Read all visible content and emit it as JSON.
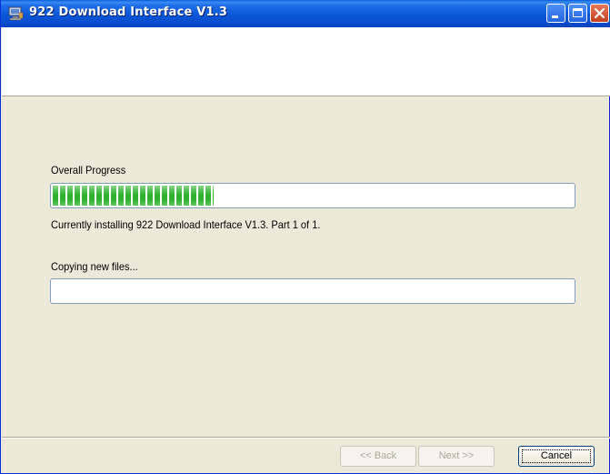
{
  "window": {
    "title": "922 Download Interface V1.3",
    "title_bar_color": "#0a56d6"
  },
  "progress": {
    "overall_label": "Overall Progress",
    "overall_fraction": 0.31,
    "overall_fill_color": "#2fb12f",
    "status_text": "Currently installing 922 Download Interface V1.3.  Part 1 of 1.",
    "file_label": "Copying new files...",
    "file_fraction": 0.0
  },
  "buttons": {
    "back_label": "<< Back",
    "next_label": "Next >>",
    "cancel_label": "Cancel"
  },
  "icons": {
    "app": "installer-computer-icon",
    "minimize": "minimize-icon",
    "maximize": "maximize-icon",
    "close": "close-icon"
  }
}
